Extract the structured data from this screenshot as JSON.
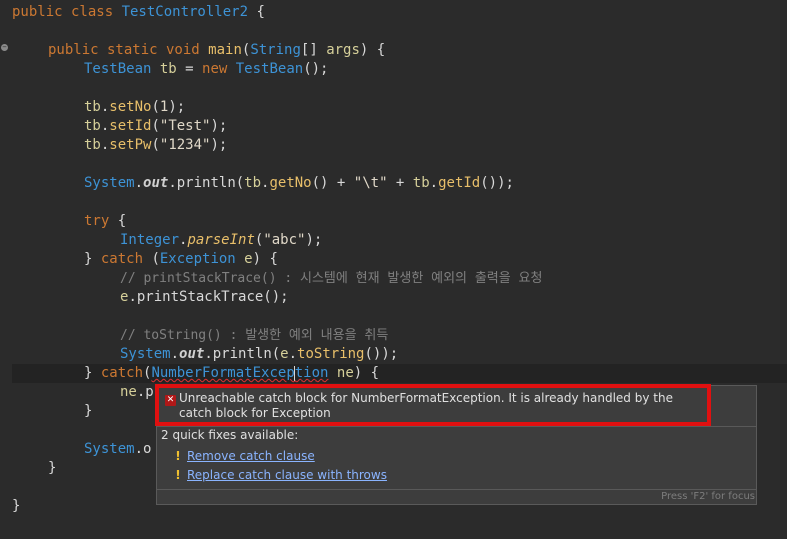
{
  "editor": {
    "lines": {
      "l1": {
        "a": "public class ",
        "b": "TestController2",
        "c": " {"
      },
      "l3": {
        "a": "public static void ",
        "b": "main",
        "c": "(",
        "d": "String",
        "e": "[] ",
        "f": "args",
        "g": ") {"
      },
      "l4": {
        "a": "TestBean",
        "b": " ",
        "c": "tb",
        "d": " = ",
        "e": "new ",
        "f": "TestBean",
        "g": "();"
      },
      "l6": {
        "a": "tb",
        "b": ".",
        "c": "setNo",
        "d": "(",
        "e": "1",
        "f": ");"
      },
      "l7": {
        "a": "tb",
        "b": ".",
        "c": "setId",
        "d": "(",
        "e": "\"Test\"",
        "f": ");"
      },
      "l8": {
        "a": "tb",
        "b": ".",
        "c": "setPw",
        "d": "(",
        "e": "\"1234\"",
        "f": ");"
      },
      "l10": {
        "a": "System",
        "b": ".",
        "c": "out",
        "d": ".println(",
        "e": "tb",
        "f": ".",
        "g": "getNo",
        "h": "() + ",
        "i": "\"\\t\"",
        "j": " + ",
        "k": "tb",
        "l": ".",
        "m": "getId",
        "n": "());"
      },
      "l12": {
        "a": "try",
        "b": " {"
      },
      "l13": {
        "a": "Integer",
        "b": ".",
        "c": "parseInt",
        "d": "(",
        "e": "\"abc\"",
        "f": ");"
      },
      "l14": {
        "a": "} ",
        "b": "catch",
        "c": " (",
        "d": "Exception",
        "e": " ",
        "f": "e",
        "g": ") {"
      },
      "l15": {
        "a": "// printStackTrace() : 시스템에 현재 발생한 예외의 출력을 요청"
      },
      "l16": {
        "a": "e",
        "b": ".printStackTrace();"
      },
      "l18": {
        "a": "// toString() : 발생한 예외 내용을 취득"
      },
      "l19": {
        "a": "System",
        "b": ".",
        "c": "out",
        "d": ".println(",
        "e": "e",
        "f": ".",
        "g": "toString",
        "h": "());"
      },
      "l20": {
        "a": "} ",
        "b": "catch",
        "c": "(",
        "d1": "NumberFormatExcep",
        "d2": "tion",
        "e": " ",
        "f": "ne",
        "g": ") {"
      },
      "l21": {
        "a": "ne",
        "b": ".p"
      },
      "l22": {
        "a": "}"
      },
      "l24": {
        "a": "System",
        "b": ".o"
      },
      "l25": {
        "a": "}"
      },
      "l27": {
        "a": "}"
      }
    },
    "colors": {
      "background": "#2b2b2b",
      "keyword": "#cc7832",
      "class": "#3d93d6",
      "method": "#e8bf6a",
      "comment": "#808080"
    }
  },
  "popup": {
    "message": "Unreachable catch block for NumberFormatException. It is already handled by the catch block for Exception",
    "fix_count": "2 quick fixes available:",
    "fixes": [
      {
        "label": "Remove catch clause"
      },
      {
        "label": "Replace catch clause with throws"
      }
    ],
    "footer_hint": "Press 'F2' for focus",
    "highlight_color": "#e01010"
  }
}
